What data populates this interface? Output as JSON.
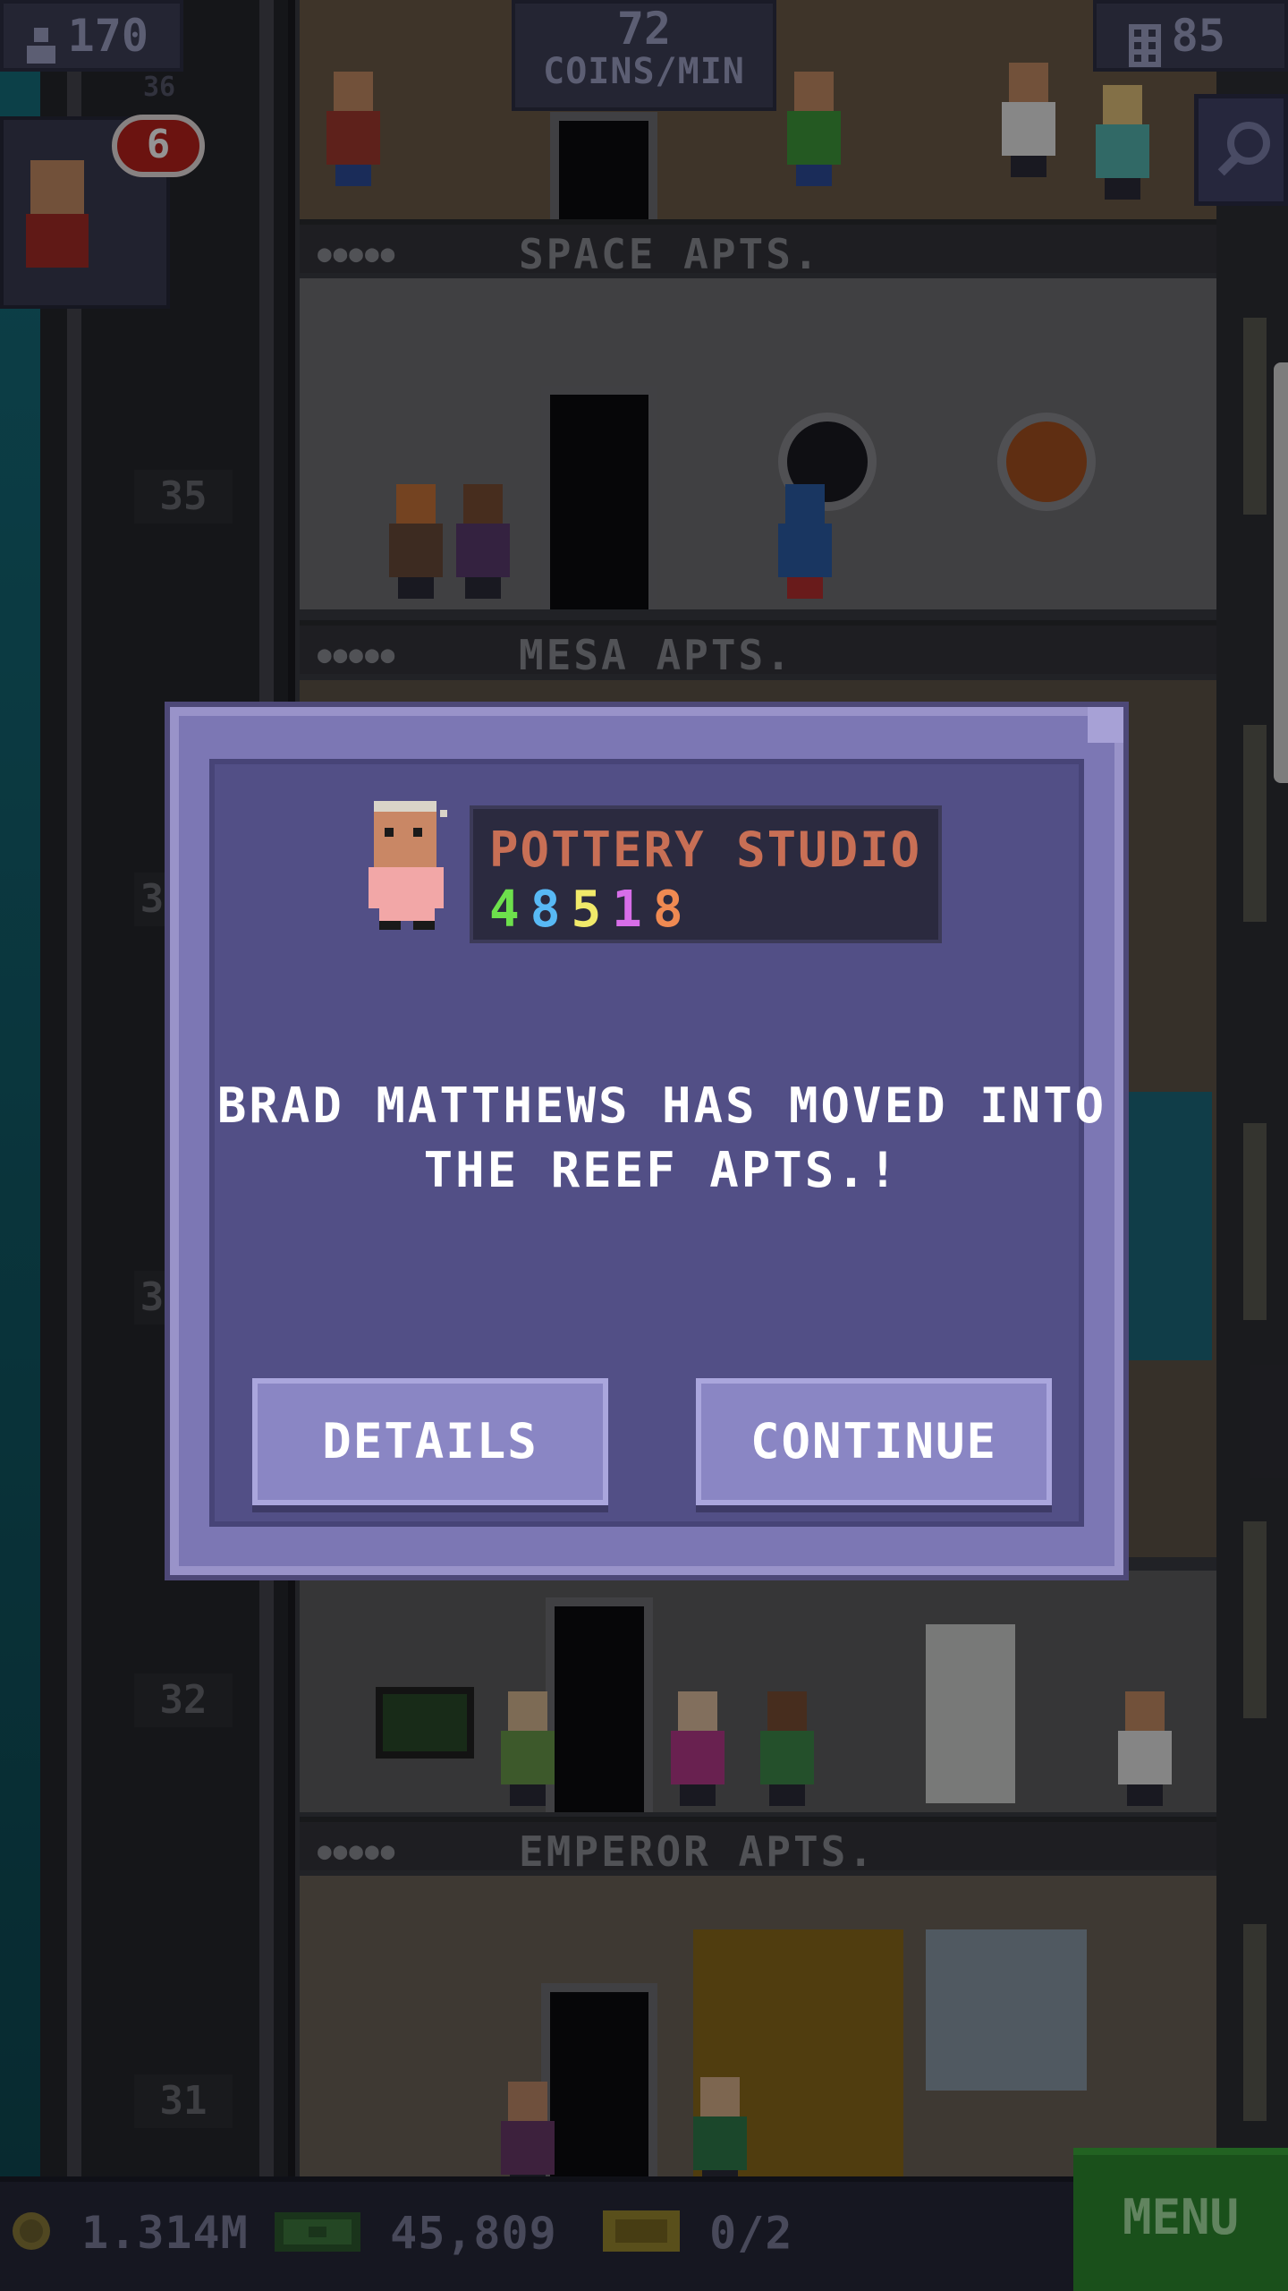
{
  "hud": {
    "population": "170",
    "coins_rate": "72",
    "coins_unit": "COINS/MIN",
    "floors": "85",
    "notification_count": "6",
    "notification_sub": "36"
  },
  "tower": {
    "floors": [
      {
        "name": "SPACE APTS."
      },
      {
        "name": "MESA APTS."
      },
      {
        "name": "EMPEROR APTS."
      }
    ],
    "elevator_numbers": [
      "35",
      "3",
      "3",
      "32",
      "31"
    ]
  },
  "dialog": {
    "business_name": "POTTERY STUDIO",
    "business_digits": [
      "4",
      "8",
      "5",
      "1",
      "8"
    ],
    "digit_colors": [
      "#6de04c",
      "#58b9f5",
      "#f1ea6a",
      "#d76ee8",
      "#f08a52"
    ],
    "message": "BRAD MATTHEWS HAS MOVED INTO THE REEF APTS.!",
    "details_label": "DETAILS",
    "continue_label": "CONTINUE"
  },
  "bottom_bar": {
    "coins": "1.314M",
    "bux": "45,809",
    "tickets": "0/2",
    "menu_label": "MENU"
  },
  "colors": {
    "dialog_frame": "#7c77b4",
    "dialog_inner": "#524f86",
    "business_name": "#c86f55",
    "menu_green": "#2e8a2f"
  }
}
